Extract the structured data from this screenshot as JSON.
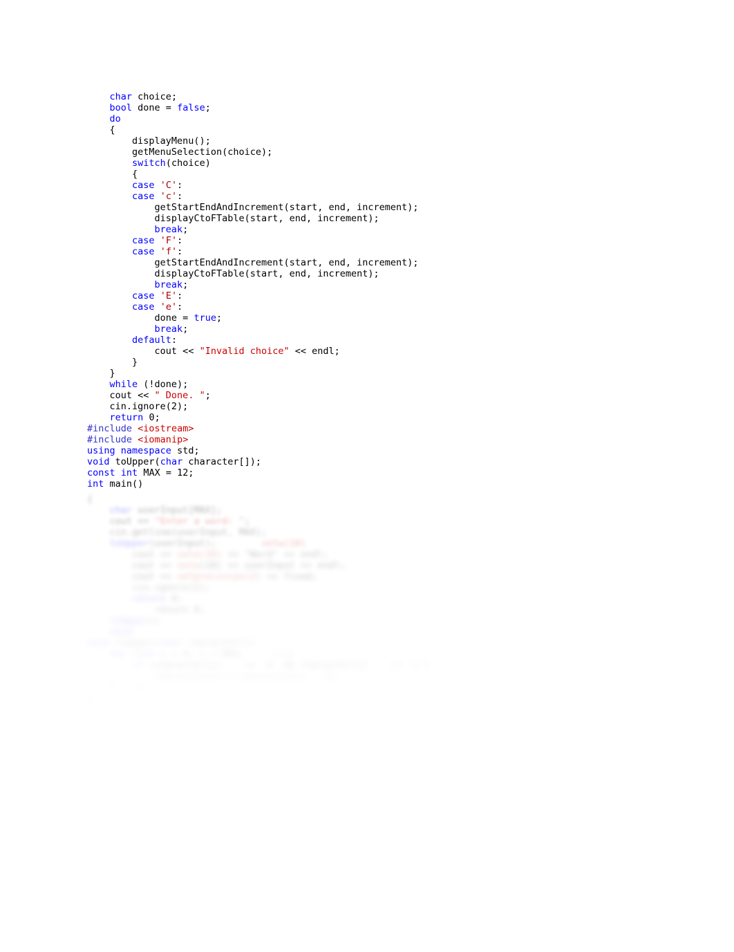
{
  "document": {
    "type": "cpp-source-listing",
    "language": "C++",
    "background_color": "#ffffff",
    "font_size_px": 13.5,
    "line_height_px": 16
  },
  "colors": {
    "keyword": "#0000FF",
    "string_literal": "#CC0000",
    "char_literal": "#AA0000",
    "preprocessor": "#3333CC",
    "header_name": "#CC0000",
    "plain_text": "#000000",
    "page_background": "#ffffff"
  },
  "code": {
    "sharp_lines": [
      "    char choice;",
      "    bool done = false;",
      "    do",
      "    {",
      "        displayMenu();",
      "        getMenuSelection(choice);",
      "        switch(choice)",
      "        {",
      "        case 'C':",
      "        case 'c':",
      "            getStartEndAndIncrement(start, end, increment);",
      "            displayCtoFTable(start, end, increment);",
      "            break;",
      "        case 'F':",
      "        case 'f':",
      "            getStartEndAndIncrement(start, end, increment);",
      "            displayCtoFTable(start, end, increment);",
      "            break;",
      "        case 'E':",
      "        case 'e':",
      "            done = true;",
      "            break;",
      "        default:",
      "            cout << \"Invalid choice\" << endl;",
      "        }",
      "    }",
      "    while (!done);",
      "    cout << \" Done. \";",
      "    cin.ignore(2);",
      "    return 0;",
      "#include <iostream>",
      "#include <iomanip>",
      "using namespace std;",
      "void toUpper(char character[]);",
      "const int MAX = 12;",
      "int main()"
    ],
    "blurred_lines": [
      "{",
      "    char userInput[MAX];",
      "    cout << \"Enter a word: \";",
      "    cin.getline(userInput, MAX);",
      "    toUpper(userInput);",
      "",
      "    cout << setw(10) << \"Word\" << setw(10) << endl;",
      "    cout << setw(10) << userInput << setw(10) << endl;",
      "    cout << setprecision(2) << fixed;",
      "    cin.ignore(2);",
      "    return 0;",
      "}",
      "",
      "void toUpper",
      "{",
      "",
      "void toUpper(char character[])",
      "{",
      "    for (int i = 0; i < MAX; i++)",
      "        if (character[i] >= 'a' && character[i] <= 'z')",
      "            character[i] = character[i] - 32;",
      "}",
      "",
      "}"
    ]
  },
  "keywords": [
    "char",
    "bool",
    "do",
    "switch",
    "case",
    "break",
    "while",
    "return",
    "int",
    "void",
    "const",
    "using",
    "namespace",
    "true",
    "false",
    "default",
    "for",
    "if"
  ],
  "string_literals": [
    "\"Invalid choice\"",
    "\" Done. \""
  ],
  "char_literals": [
    "'C'",
    "'c'",
    "'F'",
    "'f'",
    "'E'",
    "'e'"
  ],
  "headers": [
    "<iostream>",
    "<iomanip>"
  ]
}
